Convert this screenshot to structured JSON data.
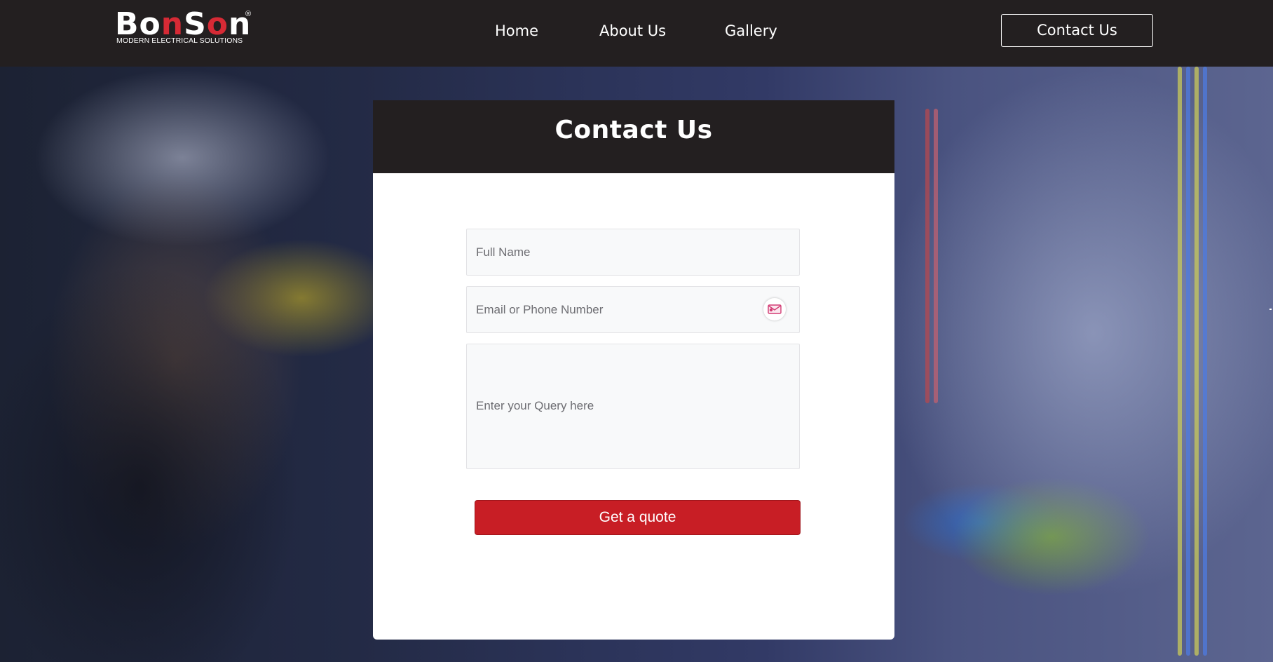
{
  "header": {
    "logo": {
      "brand": "BonSon",
      "registered": "®",
      "tagline": "MODERN ELECTRICAL SOLUTIONS"
    },
    "nav": [
      {
        "label": "Home"
      },
      {
        "label": "About Us"
      },
      {
        "label": "Gallery"
      }
    ],
    "cta_label": "Contact Us"
  },
  "hero": {
    "background": "photo-electrician-panel"
  },
  "form": {
    "title": "Contact Us",
    "name_placeholder": "Full Name",
    "name_value": "",
    "contact_placeholder": "Email or Phone Number",
    "contact_value": "",
    "contact_icon": "mail-extension-icon",
    "query_placeholder": "Enter your Query here",
    "query_value": "",
    "submit_label": "Get a quote"
  },
  "colors": {
    "header_bg": "#231f20",
    "accent_red": "#c81e25",
    "logo_o": "#d62a35",
    "field_bg": "#f8f9fa"
  }
}
